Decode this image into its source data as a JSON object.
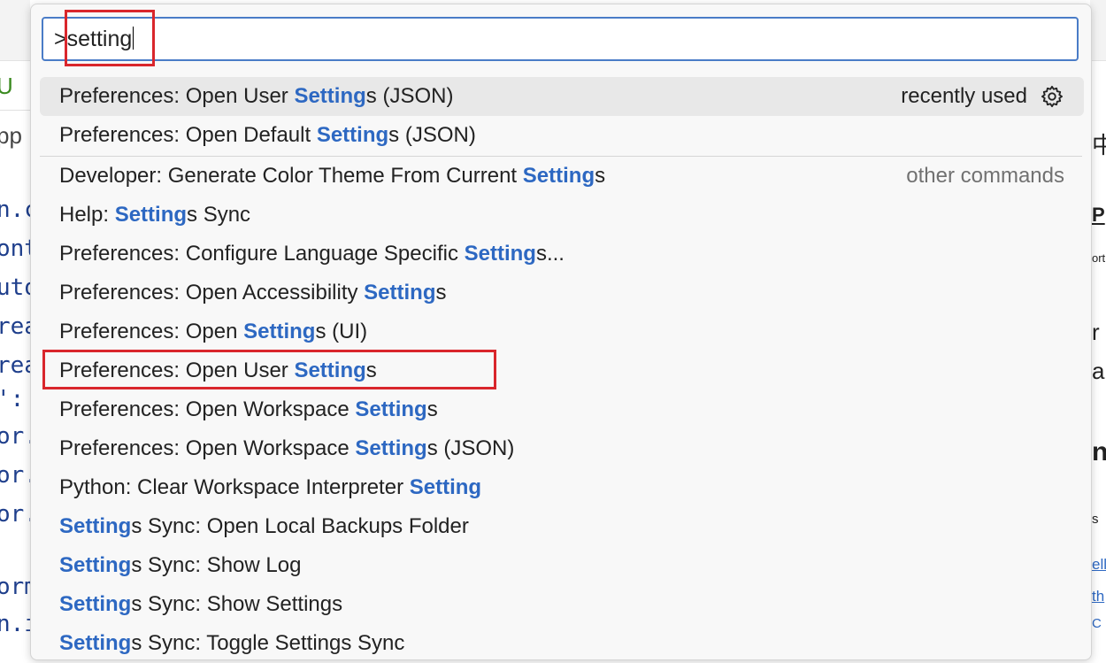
{
  "background_editor": {
    "fragments": [
      "U",
      "pp",
      "n.c",
      "ont",
      "uto",
      "rea",
      "rea",
      "':",
      "or.",
      "or.",
      "or.",
      "orm",
      "n.i"
    ]
  },
  "background_panel": {
    "fragments": [
      "中",
      "P",
      "ort",
      "r",
      "ar",
      "ng",
      "s",
      "elli",
      "th",
      "C"
    ]
  },
  "command_palette": {
    "input_value": ">setting",
    "items": [
      {
        "prefix": "Preferences: Open User ",
        "match": "Setting",
        "suffix": "s (JSON)",
        "meta": "recently used"
      },
      {
        "prefix": "Preferences: Open Default ",
        "match": "Setting",
        "suffix": "s (JSON)",
        "meta": ""
      },
      {
        "prefix": "Developer: Generate Color Theme From Current ",
        "match": "Setting",
        "suffix": "s",
        "meta": "other commands"
      },
      {
        "prefix": "Help: ",
        "match": "Setting",
        "suffix": "s Sync",
        "meta": ""
      },
      {
        "prefix": "Preferences: Configure Language Specific ",
        "match": "Setting",
        "suffix": "s...",
        "meta": ""
      },
      {
        "prefix": "Preferences: Open Accessibility ",
        "match": "Setting",
        "suffix": "s",
        "meta": ""
      },
      {
        "prefix": "Preferences: Open ",
        "match": "Setting",
        "suffix": "s (UI)",
        "meta": ""
      },
      {
        "prefix": "Preferences: Open User ",
        "match": "Setting",
        "suffix": "s",
        "meta": ""
      },
      {
        "prefix": "Preferences: Open Workspace ",
        "match": "Setting",
        "suffix": "s",
        "meta": ""
      },
      {
        "prefix": "Preferences: Open Workspace ",
        "match": "Setting",
        "suffix": "s (JSON)",
        "meta": ""
      },
      {
        "prefix": "Python: Clear Workspace Interpreter ",
        "match": "Setting",
        "suffix": "",
        "meta": ""
      },
      {
        "prefix": "",
        "match": "Setting",
        "suffix": "s Sync: Open Local Backups Folder",
        "meta": ""
      },
      {
        "prefix": "",
        "match": "Setting",
        "suffix": "s Sync: Show Log",
        "meta": ""
      },
      {
        "prefix": "",
        "match": "Setting",
        "suffix": "s Sync: Show Settings",
        "meta": ""
      },
      {
        "prefix": "",
        "match": "Setting",
        "suffix": "s Sync: Toggle Settings Sync",
        "meta": ""
      }
    ]
  },
  "icons": {
    "configure_keybinding": "gear-icon"
  },
  "colors": {
    "match_highlight": "#2d68c2",
    "input_border": "#4a7cc7",
    "annotation_box": "#d9262c"
  }
}
